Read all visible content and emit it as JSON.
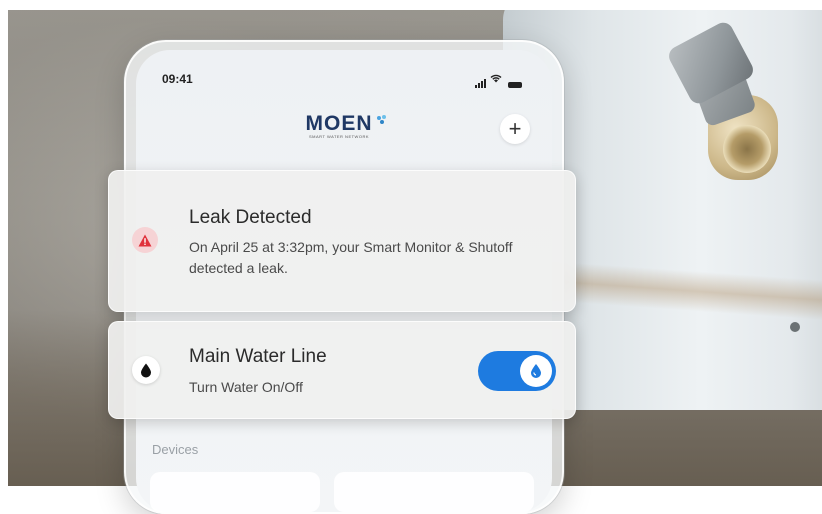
{
  "status_bar": {
    "time": "09:41"
  },
  "header": {
    "logo_text": "MOEN",
    "logo_subtext": "SMART WATER NETWORK",
    "add_label": "+"
  },
  "alert": {
    "title": "Leak Detected",
    "message": "On April 25 at 3:32pm, your Smart Monitor & Shutoff detected a leak.",
    "icon": "warning-triangle-icon",
    "icon_color": "#e0323c"
  },
  "water_line": {
    "title": "Main Water Line",
    "subtitle": "Turn Water On/Off",
    "icon": "water-drop-icon",
    "toggle_on": true,
    "toggle_color": "#1e7be0"
  },
  "devices": {
    "label": "Devices"
  }
}
